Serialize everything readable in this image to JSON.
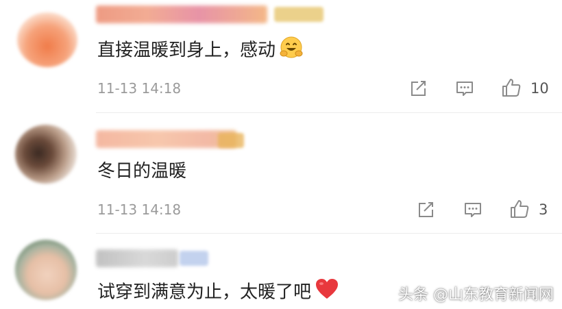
{
  "comments": [
    {
      "text": "直接温暖到身上，感动",
      "emoji": "smiling-face-with-hands-emoji",
      "time": "11-13 14:18",
      "like_count": "10"
    },
    {
      "text": "冬日的温暖",
      "time": "11-13 14:18",
      "like_count": "3"
    },
    {
      "text": "试穿到满意为止，太暖了吧",
      "emoji": "red-heart-emoji"
    }
  ],
  "watermark": "头条 @山东教育新闻网",
  "colors": {
    "text": "#222222",
    "meta": "#9a9a9a",
    "icon": "#8a8a8a",
    "heart": "#e8383d",
    "divider": "#ececec"
  }
}
